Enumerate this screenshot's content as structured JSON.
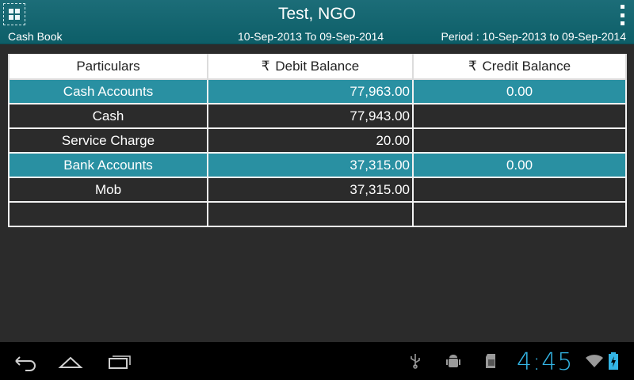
{
  "header": {
    "title": "Test, NGO",
    "subtitle_left": "Cash Book",
    "date_range": "10-Sep-2013 To 09-Sep-2014",
    "period": "Period : 10-Sep-2013 to 09-Sep-2014"
  },
  "table": {
    "columns": {
      "particulars": "Particulars",
      "debit": "Debit Balance",
      "credit": "Credit Balance",
      "currency_symbol": "₹"
    },
    "rows": [
      {
        "type": "group",
        "particulars": "Cash Accounts",
        "debit": "77,963.00",
        "credit": "0.00"
      },
      {
        "type": "item",
        "particulars": "Cash",
        "debit": "77,943.00",
        "credit": ""
      },
      {
        "type": "item",
        "particulars": "Service Charge",
        "debit": "20.00",
        "credit": ""
      },
      {
        "type": "group",
        "particulars": "Bank Accounts",
        "debit": "37,315.00",
        "credit": "0.00"
      },
      {
        "type": "item",
        "particulars": "Mob",
        "debit": "37,315.00",
        "credit": ""
      },
      {
        "type": "item",
        "particulars": "",
        "debit": "",
        "credit": ""
      }
    ]
  },
  "status_bar": {
    "clock": "4:45",
    "icons": [
      "usb-icon",
      "android-debug-icon",
      "sd-card-icon",
      "wifi-icon",
      "battery-charging-icon"
    ]
  },
  "nav_bar": {
    "buttons": [
      "back-icon",
      "home-icon",
      "recent-apps-icon"
    ]
  },
  "colors": {
    "header_bg": "#0d5e68",
    "group_row_bg": "#2990a2",
    "body_bg": "#2b2b2b",
    "clock_color": "#33b5e5"
  }
}
